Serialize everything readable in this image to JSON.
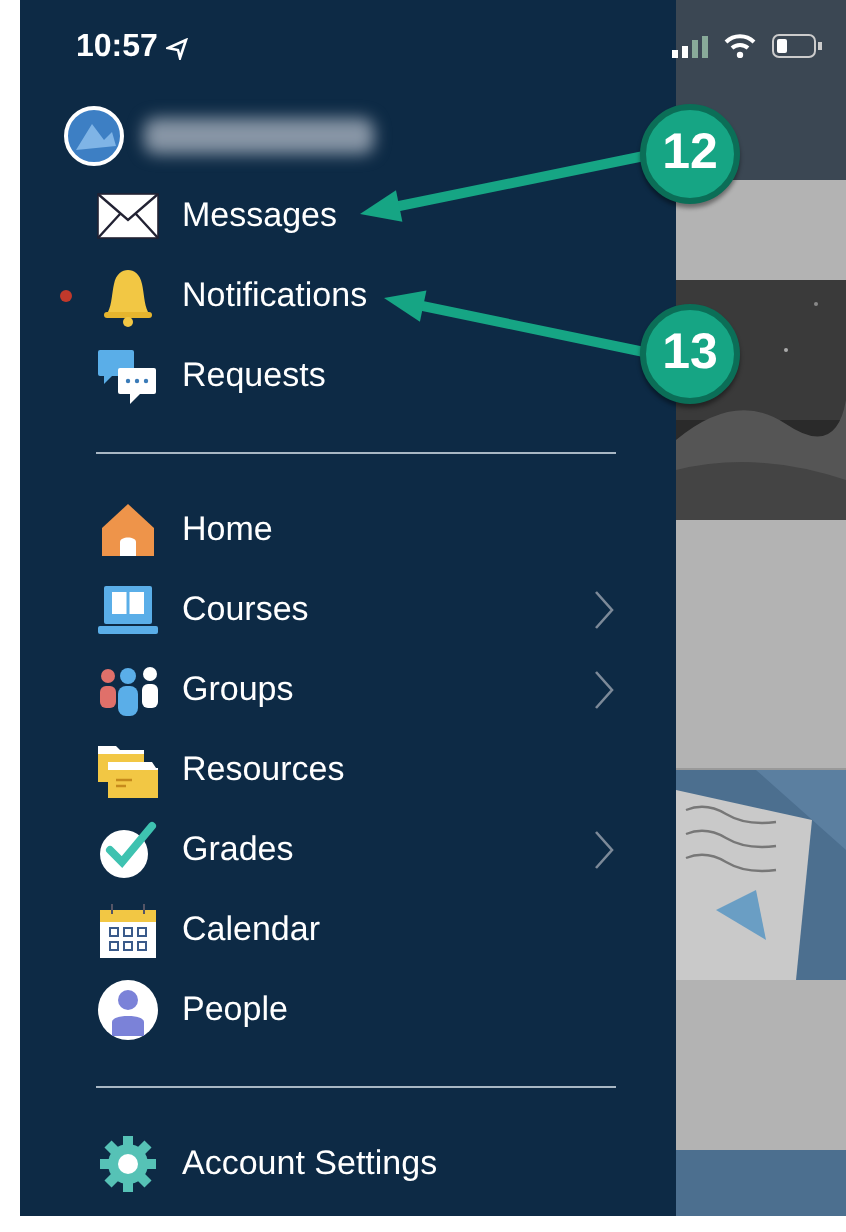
{
  "status_bar": {
    "time": "10:57",
    "location_arrow": true
  },
  "profile": {
    "kind": "avatar"
  },
  "menu_sections": [
    {
      "items": [
        {
          "kind": "envelope",
          "label": "Messages",
          "unread": false,
          "chevron": false
        },
        {
          "kind": "bell",
          "label": "Notifications",
          "unread": true,
          "chevron": false
        },
        {
          "kind": "chat",
          "label": "Requests",
          "unread": false,
          "chevron": false
        }
      ]
    },
    {
      "items": [
        {
          "kind": "house",
          "label": "Home",
          "unread": false,
          "chevron": false
        },
        {
          "kind": "laptop",
          "label": "Courses",
          "unread": false,
          "chevron": true
        },
        {
          "kind": "group",
          "label": "Groups",
          "unread": false,
          "chevron": true
        },
        {
          "kind": "folder",
          "label": "Resources",
          "unread": false,
          "chevron": false
        },
        {
          "kind": "check",
          "label": "Grades",
          "unread": false,
          "chevron": true
        },
        {
          "kind": "calendar",
          "label": "Calendar",
          "unread": false,
          "chevron": false
        },
        {
          "kind": "person",
          "label": "People",
          "unread": false,
          "chevron": false
        }
      ]
    },
    {
      "items": [
        {
          "kind": "gear",
          "label": "Account Settings",
          "unread": false,
          "chevron": false
        }
      ]
    }
  ],
  "callouts": [
    {
      "number": "12"
    },
    {
      "number": "13"
    }
  ]
}
